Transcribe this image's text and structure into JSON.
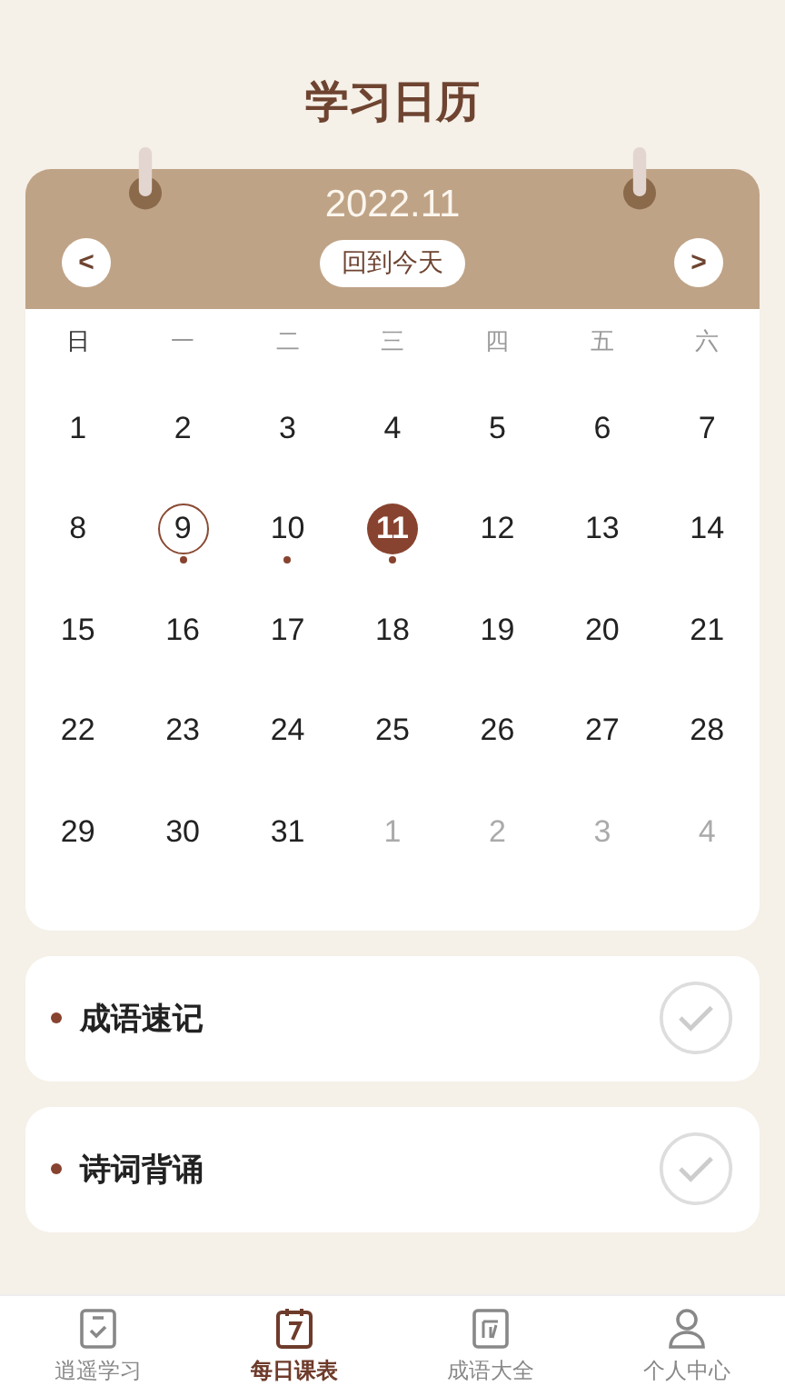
{
  "title": "学习日历",
  "calendar": {
    "month": "2022.11",
    "today_button": "回到今天",
    "prev": "<",
    "next": ">",
    "weekdays": [
      "日",
      "一",
      "二",
      "三",
      "四",
      "五",
      "六"
    ],
    "days": [
      {
        "label": "1",
        "muted": false,
        "marked": false,
        "selected": false,
        "outlined": false
      },
      {
        "label": "2",
        "muted": false,
        "marked": false,
        "selected": false,
        "outlined": false
      },
      {
        "label": "3",
        "muted": false,
        "marked": false,
        "selected": false,
        "outlined": false
      },
      {
        "label": "4",
        "muted": false,
        "marked": false,
        "selected": false,
        "outlined": false
      },
      {
        "label": "5",
        "muted": false,
        "marked": false,
        "selected": false,
        "outlined": false
      },
      {
        "label": "6",
        "muted": false,
        "marked": false,
        "selected": false,
        "outlined": false
      },
      {
        "label": "7",
        "muted": false,
        "marked": false,
        "selected": false,
        "outlined": false
      },
      {
        "label": "8",
        "muted": false,
        "marked": false,
        "selected": false,
        "outlined": false
      },
      {
        "label": "9",
        "muted": false,
        "marked": true,
        "selected": false,
        "outlined": true
      },
      {
        "label": "10",
        "muted": false,
        "marked": true,
        "selected": false,
        "outlined": false
      },
      {
        "label": "11",
        "muted": false,
        "marked": true,
        "selected": true,
        "outlined": false
      },
      {
        "label": "12",
        "muted": false,
        "marked": false,
        "selected": false,
        "outlined": false
      },
      {
        "label": "13",
        "muted": false,
        "marked": false,
        "selected": false,
        "outlined": false
      },
      {
        "label": "14",
        "muted": false,
        "marked": false,
        "selected": false,
        "outlined": false
      },
      {
        "label": "15",
        "muted": false,
        "marked": false,
        "selected": false,
        "outlined": false
      },
      {
        "label": "16",
        "muted": false,
        "marked": false,
        "selected": false,
        "outlined": false
      },
      {
        "label": "17",
        "muted": false,
        "marked": false,
        "selected": false,
        "outlined": false
      },
      {
        "label": "18",
        "muted": false,
        "marked": false,
        "selected": false,
        "outlined": false
      },
      {
        "label": "19",
        "muted": false,
        "marked": false,
        "selected": false,
        "outlined": false
      },
      {
        "label": "20",
        "muted": false,
        "marked": false,
        "selected": false,
        "outlined": false
      },
      {
        "label": "21",
        "muted": false,
        "marked": false,
        "selected": false,
        "outlined": false
      },
      {
        "label": "22",
        "muted": false,
        "marked": false,
        "selected": false,
        "outlined": false
      },
      {
        "label": "23",
        "muted": false,
        "marked": false,
        "selected": false,
        "outlined": false
      },
      {
        "label": "24",
        "muted": false,
        "marked": false,
        "selected": false,
        "outlined": false
      },
      {
        "label": "25",
        "muted": false,
        "marked": false,
        "selected": false,
        "outlined": false
      },
      {
        "label": "26",
        "muted": false,
        "marked": false,
        "selected": false,
        "outlined": false
      },
      {
        "label": "27",
        "muted": false,
        "marked": false,
        "selected": false,
        "outlined": false
      },
      {
        "label": "28",
        "muted": false,
        "marked": false,
        "selected": false,
        "outlined": false
      },
      {
        "label": "29",
        "muted": false,
        "marked": false,
        "selected": false,
        "outlined": false
      },
      {
        "label": "30",
        "muted": false,
        "marked": false,
        "selected": false,
        "outlined": false
      },
      {
        "label": "31",
        "muted": false,
        "marked": false,
        "selected": false,
        "outlined": false
      },
      {
        "label": "1",
        "muted": true,
        "marked": false,
        "selected": false,
        "outlined": false
      },
      {
        "label": "2",
        "muted": true,
        "marked": false,
        "selected": false,
        "outlined": false
      },
      {
        "label": "3",
        "muted": true,
        "marked": false,
        "selected": false,
        "outlined": false
      },
      {
        "label": "4",
        "muted": true,
        "marked": false,
        "selected": false,
        "outlined": false
      }
    ]
  },
  "tasks": [
    {
      "label": "成语速记",
      "checked": false
    },
    {
      "label": "诗词背诵",
      "checked": false
    }
  ],
  "tabs": [
    {
      "label": "逍遥学习",
      "kind": "checklist",
      "selected": false
    },
    {
      "label": "每日课表",
      "kind": "calendar",
      "selected": true
    },
    {
      "label": "成语大全",
      "kind": "idiom",
      "selected": false
    },
    {
      "label": "个人中心",
      "kind": "person",
      "selected": false
    }
  ]
}
